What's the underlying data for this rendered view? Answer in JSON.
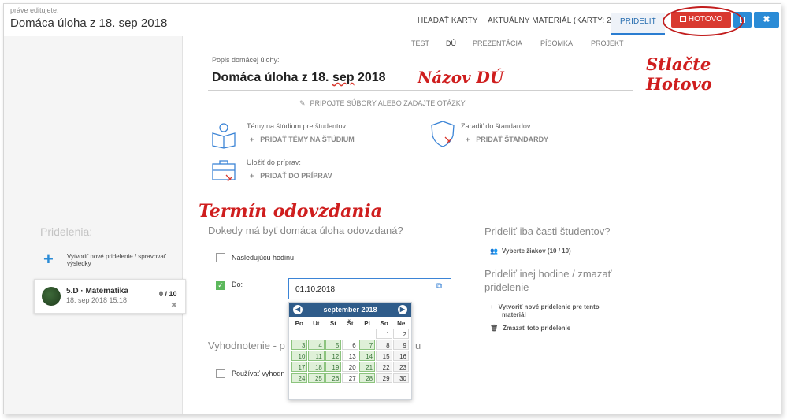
{
  "header": {
    "editing_label": "práve editujete:",
    "title": "Domáca úloha z 18. sep 2018",
    "tabs": [
      "HĽADAŤ KARTY",
      "AKTUÁLNY MATERIÁL (KARTY: 2)",
      "PRIDELIŤ"
    ],
    "done_label": "HOTOVO",
    "close_label": "✖"
  },
  "type_tabs": [
    "TEST",
    "DÚ",
    "PREZENTÁCIA",
    "PÍSOMKA",
    "PROJEKT"
  ],
  "description": {
    "label": "Popis domácej úlohy:",
    "value_part1": "Domáca úloha z 18. ",
    "value_part2": "sep",
    "value_part3": " 2018"
  },
  "attach_label": "PRIPOJTE SÚBORY ALEBO ZADAJTE OTÁZKY",
  "topics": {
    "label": "Témy na štúdium pre študentov:",
    "action": "PRIDAŤ TÉMY NA ŠTÚDIUM"
  },
  "standards": {
    "label": "Zaradiť do štandardov:",
    "action": "PRIDAŤ ŠTANDARDY"
  },
  "prep": {
    "label": "Uložiť do príprav:",
    "action": "PRIDAŤ DO PRÍPRAV"
  },
  "annotations": {
    "name": "Názov DÚ",
    "done": "Stlačte Hotovo",
    "deadline": "Termín odovzdania"
  },
  "sidebar": {
    "title": "Pridelenia:",
    "new_assign": "Vytvoriť nové pridelenie / spravovať výsledky",
    "class_name": "5.D · Matematika",
    "class_date": "18. sep 2018 15:18",
    "class_count": "0 / 10"
  },
  "deadline": {
    "question": "Dokedy má byť domáca úloha odovzdaná?",
    "next_lesson": "Nasledujúcu hodinu",
    "to_label": "Do:",
    "date_value": "01.10.2018"
  },
  "evaluation": {
    "title_start": "Vyhodnotenie - p",
    "title_end": "u",
    "use_label": "Používať vyhodn"
  },
  "calendar": {
    "month": "september 2018",
    "weekdays": [
      "Po",
      "Ut",
      "St",
      "Št",
      "Pi",
      "So",
      "Ne"
    ],
    "rows": [
      [
        "",
        "",
        "",
        "",
        "",
        "1",
        "2"
      ],
      [
        "3",
        "4",
        "5",
        "6",
        "7",
        "8",
        "9"
      ],
      [
        "10",
        "11",
        "12",
        "13",
        "14",
        "15",
        "16"
      ],
      [
        "17",
        "18",
        "19",
        "20",
        "21",
        "22",
        "23"
      ],
      [
        "24",
        "25",
        "26",
        "27",
        "28",
        "29",
        "30"
      ]
    ]
  },
  "right_panel": {
    "part_title": "Prideliť iba časti študentov?",
    "select_students": "Vyberte žiakov (10 / 10)",
    "other_title_1": "Prideliť inej hodine / zmazať",
    "other_title_2": "pridelenie",
    "create_new_1": "Vytvoriť nové pridelenie pre tento",
    "create_new_2": "materiál",
    "delete": "Zmazať toto pridelenie"
  }
}
